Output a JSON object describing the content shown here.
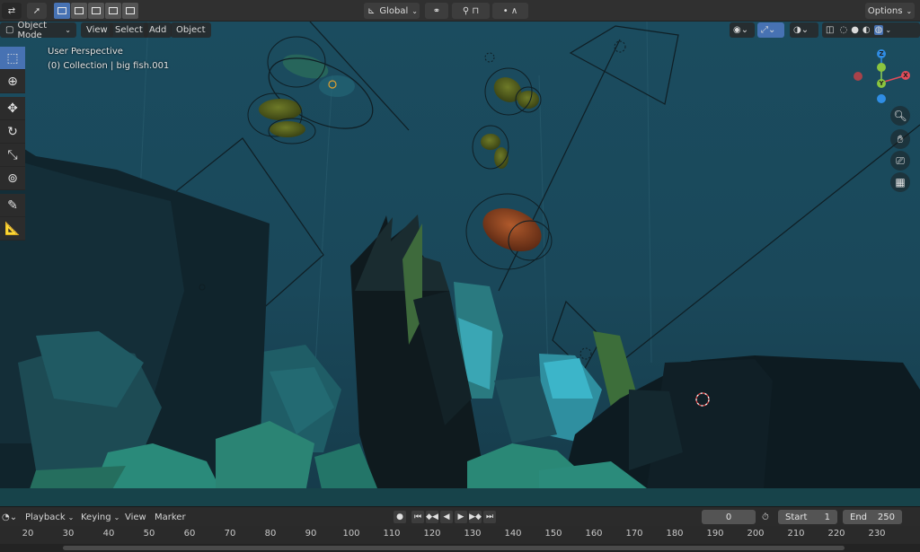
{
  "topbar": {
    "transform_orientation": "Global",
    "options_label": "Options"
  },
  "header": {
    "mode_label": "Object Mode",
    "menus": [
      "View",
      "Select",
      "Add",
      "Object"
    ]
  },
  "viewport": {
    "view_name": "User Perspective",
    "collection_info": "(0) Collection | big fish.001",
    "axes": {
      "x": "X",
      "y": "Y",
      "z": "Z"
    }
  },
  "colors": {
    "accent": "#4772b3",
    "viewport_bg": "#1a4a5c",
    "axis_x": "#e24c5a",
    "axis_y": "#8bc53f",
    "axis_z": "#2f8de4"
  },
  "icons": {
    "toolbar": [
      "select-cursor-icon",
      "cursor-icon",
      "move-icon",
      "rotate-icon",
      "scale-icon",
      "transform-icon",
      "annotate-icon",
      "measure-icon"
    ],
    "nav": [
      "zoom-icon",
      "hand-icon",
      "camera-icon",
      "grid-icon"
    ]
  },
  "timeline": {
    "menus": [
      "Playback",
      "Keying",
      "View",
      "Marker"
    ],
    "current_frame": "0",
    "start_label": "Start",
    "start_value": "1",
    "end_label": "End",
    "end_value": "250",
    "ticks": [
      "20",
      "30",
      "40",
      "50",
      "60",
      "70",
      "80",
      "90",
      "100",
      "110",
      "120",
      "130",
      "140",
      "150",
      "160",
      "170",
      "180",
      "190",
      "200",
      "210",
      "220",
      "230"
    ]
  }
}
